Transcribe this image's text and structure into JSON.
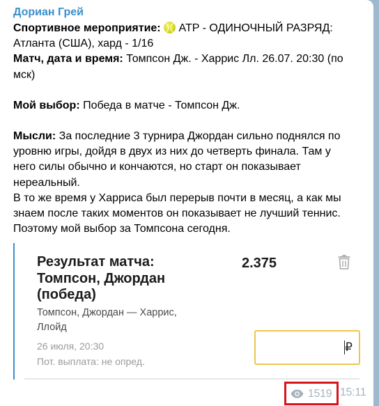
{
  "author": "Дориан Грей",
  "post": {
    "line1_label": "Спортивное мероприятие:",
    "line1_event": "ATP - ОДИНОЧНЫЙ РАЗРЯД:",
    "line2": "Атланта (США), хард - 1/16",
    "line3_label": "Матч, дата и время:",
    "line3_value": "Томпсон Дж. - Харрис Лл.  26.07. 20:30 (по",
    "line4": "мск)",
    "choice_label": "Мой выбор:",
    "choice_value": "Победа в матче - Томпсон Дж.",
    "thoughts_label": "Мысли:",
    "thoughts_l1": "За последние 3 турнира Джордан сильно поднялся по",
    "thoughts_l2": "уровню игры, дойдя в двух из них до четверть финала. Там у",
    "thoughts_l3": "него силы обычно и кончаются, но старт он показывает",
    "thoughts_l4": "нереальный.",
    "thoughts_l5": "В то же время у Харриса был перерыв почти в месяц, а как мы",
    "thoughts_l6": "знаем после таких моментов он показывает не лучший теннис.",
    "thoughts_l7": "Поэтому мой выбор за Томпсона сегодня."
  },
  "bet_card": {
    "title_l1": "Результат матча:",
    "title_l2": "Томпсон, Джордан",
    "title_l3": "(победа)",
    "odds": "2.375",
    "participants_l1": "Томпсон, Джордан — Харрис,",
    "participants_l2": "Ллойд",
    "datetime": "26 июля, 20:30",
    "payout": "Пот. выплата: не опред.",
    "stake_value": "",
    "currency": "₽"
  },
  "meta": {
    "views": "1519",
    "time": "15:11"
  },
  "icons": {
    "ball": "tennis-ball-icon",
    "trash": "trash-icon",
    "eye": "eye-icon"
  },
  "colors": {
    "author": "#3c8fc9",
    "accent_bar": "#3c8fc9",
    "input_border": "#efc64b",
    "highlight_box": "#d6141c",
    "meta_text": "#a6b3bf",
    "background": "#9db8cf"
  }
}
